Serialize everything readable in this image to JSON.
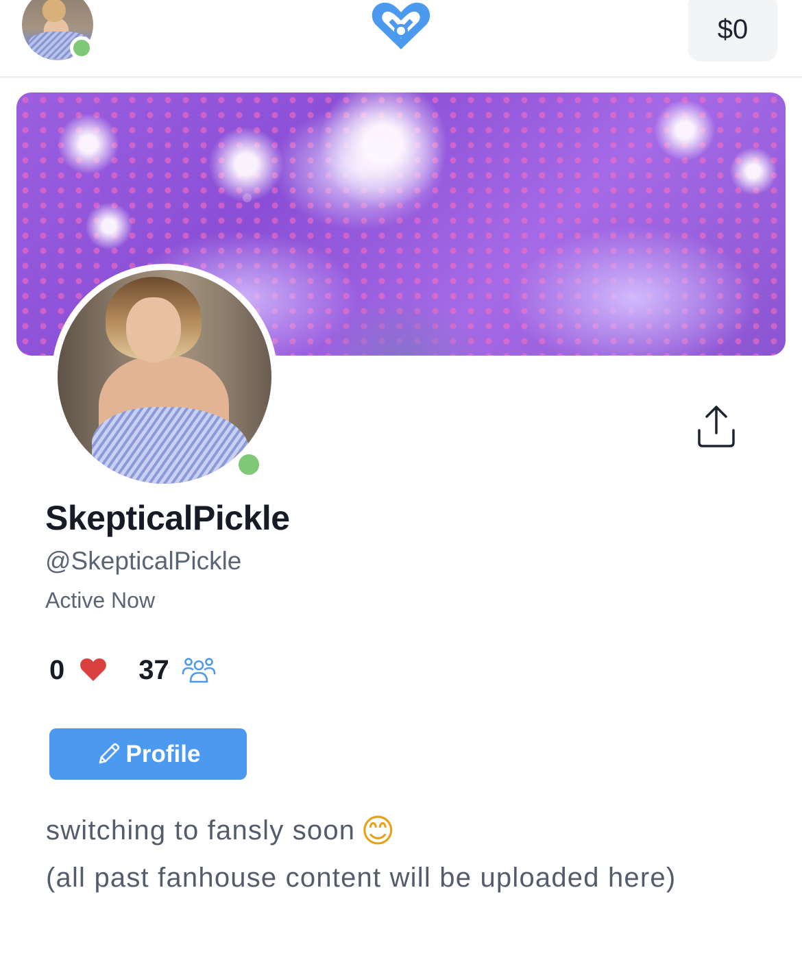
{
  "header": {
    "balance": "$0",
    "brand_color": "#4c9af0"
  },
  "profile": {
    "display_name": "SkepticalPickle",
    "handle": "@SkepticalPickle",
    "status": "Active Now",
    "status_color": "#7ec878",
    "likes_count": "0",
    "followers_count": "37",
    "edit_button_label": "Profile",
    "bio_line_1": "switching to fansly soon",
    "bio_emoji": "😊",
    "bio_line_2": "(all past fanhouse content will be uploaded here)"
  },
  "icons": {
    "logo": "heart-logo-icon",
    "share": "share-upload-icon",
    "likes": "heart-icon",
    "followers": "people-icon",
    "edit": "pencil-icon"
  }
}
